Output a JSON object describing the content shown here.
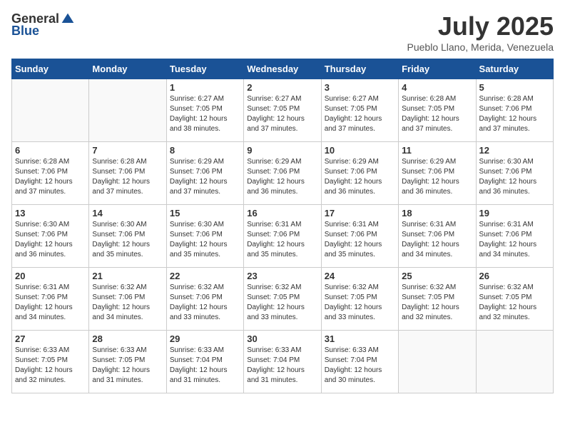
{
  "logo": {
    "general": "General",
    "blue": "Blue"
  },
  "title": "July 2025",
  "location": "Pueblo Llano, Merida, Venezuela",
  "days_of_week": [
    "Sunday",
    "Monday",
    "Tuesday",
    "Wednesday",
    "Thursday",
    "Friday",
    "Saturday"
  ],
  "weeks": [
    [
      {
        "day": "",
        "info": ""
      },
      {
        "day": "",
        "info": ""
      },
      {
        "day": "1",
        "info": "Sunrise: 6:27 AM\nSunset: 7:05 PM\nDaylight: 12 hours\nand 38 minutes."
      },
      {
        "day": "2",
        "info": "Sunrise: 6:27 AM\nSunset: 7:05 PM\nDaylight: 12 hours\nand 37 minutes."
      },
      {
        "day": "3",
        "info": "Sunrise: 6:27 AM\nSunset: 7:05 PM\nDaylight: 12 hours\nand 37 minutes."
      },
      {
        "day": "4",
        "info": "Sunrise: 6:28 AM\nSunset: 7:05 PM\nDaylight: 12 hours\nand 37 minutes."
      },
      {
        "day": "5",
        "info": "Sunrise: 6:28 AM\nSunset: 7:06 PM\nDaylight: 12 hours\nand 37 minutes."
      }
    ],
    [
      {
        "day": "6",
        "info": "Sunrise: 6:28 AM\nSunset: 7:06 PM\nDaylight: 12 hours\nand 37 minutes."
      },
      {
        "day": "7",
        "info": "Sunrise: 6:28 AM\nSunset: 7:06 PM\nDaylight: 12 hours\nand 37 minutes."
      },
      {
        "day": "8",
        "info": "Sunrise: 6:29 AM\nSunset: 7:06 PM\nDaylight: 12 hours\nand 37 minutes."
      },
      {
        "day": "9",
        "info": "Sunrise: 6:29 AM\nSunset: 7:06 PM\nDaylight: 12 hours\nand 36 minutes."
      },
      {
        "day": "10",
        "info": "Sunrise: 6:29 AM\nSunset: 7:06 PM\nDaylight: 12 hours\nand 36 minutes."
      },
      {
        "day": "11",
        "info": "Sunrise: 6:29 AM\nSunset: 7:06 PM\nDaylight: 12 hours\nand 36 minutes."
      },
      {
        "day": "12",
        "info": "Sunrise: 6:30 AM\nSunset: 7:06 PM\nDaylight: 12 hours\nand 36 minutes."
      }
    ],
    [
      {
        "day": "13",
        "info": "Sunrise: 6:30 AM\nSunset: 7:06 PM\nDaylight: 12 hours\nand 36 minutes."
      },
      {
        "day": "14",
        "info": "Sunrise: 6:30 AM\nSunset: 7:06 PM\nDaylight: 12 hours\nand 35 minutes."
      },
      {
        "day": "15",
        "info": "Sunrise: 6:30 AM\nSunset: 7:06 PM\nDaylight: 12 hours\nand 35 minutes."
      },
      {
        "day": "16",
        "info": "Sunrise: 6:31 AM\nSunset: 7:06 PM\nDaylight: 12 hours\nand 35 minutes."
      },
      {
        "day": "17",
        "info": "Sunrise: 6:31 AM\nSunset: 7:06 PM\nDaylight: 12 hours\nand 35 minutes."
      },
      {
        "day": "18",
        "info": "Sunrise: 6:31 AM\nSunset: 7:06 PM\nDaylight: 12 hours\nand 34 minutes."
      },
      {
        "day": "19",
        "info": "Sunrise: 6:31 AM\nSunset: 7:06 PM\nDaylight: 12 hours\nand 34 minutes."
      }
    ],
    [
      {
        "day": "20",
        "info": "Sunrise: 6:31 AM\nSunset: 7:06 PM\nDaylight: 12 hours\nand 34 minutes."
      },
      {
        "day": "21",
        "info": "Sunrise: 6:32 AM\nSunset: 7:06 PM\nDaylight: 12 hours\nand 34 minutes."
      },
      {
        "day": "22",
        "info": "Sunrise: 6:32 AM\nSunset: 7:06 PM\nDaylight: 12 hours\nand 33 minutes."
      },
      {
        "day": "23",
        "info": "Sunrise: 6:32 AM\nSunset: 7:05 PM\nDaylight: 12 hours\nand 33 minutes."
      },
      {
        "day": "24",
        "info": "Sunrise: 6:32 AM\nSunset: 7:05 PM\nDaylight: 12 hours\nand 33 minutes."
      },
      {
        "day": "25",
        "info": "Sunrise: 6:32 AM\nSunset: 7:05 PM\nDaylight: 12 hours\nand 32 minutes."
      },
      {
        "day": "26",
        "info": "Sunrise: 6:32 AM\nSunset: 7:05 PM\nDaylight: 12 hours\nand 32 minutes."
      }
    ],
    [
      {
        "day": "27",
        "info": "Sunrise: 6:33 AM\nSunset: 7:05 PM\nDaylight: 12 hours\nand 32 minutes."
      },
      {
        "day": "28",
        "info": "Sunrise: 6:33 AM\nSunset: 7:05 PM\nDaylight: 12 hours\nand 31 minutes."
      },
      {
        "day": "29",
        "info": "Sunrise: 6:33 AM\nSunset: 7:04 PM\nDaylight: 12 hours\nand 31 minutes."
      },
      {
        "day": "30",
        "info": "Sunrise: 6:33 AM\nSunset: 7:04 PM\nDaylight: 12 hours\nand 31 minutes."
      },
      {
        "day": "31",
        "info": "Sunrise: 6:33 AM\nSunset: 7:04 PM\nDaylight: 12 hours\nand 30 minutes."
      },
      {
        "day": "",
        "info": ""
      },
      {
        "day": "",
        "info": ""
      }
    ]
  ]
}
